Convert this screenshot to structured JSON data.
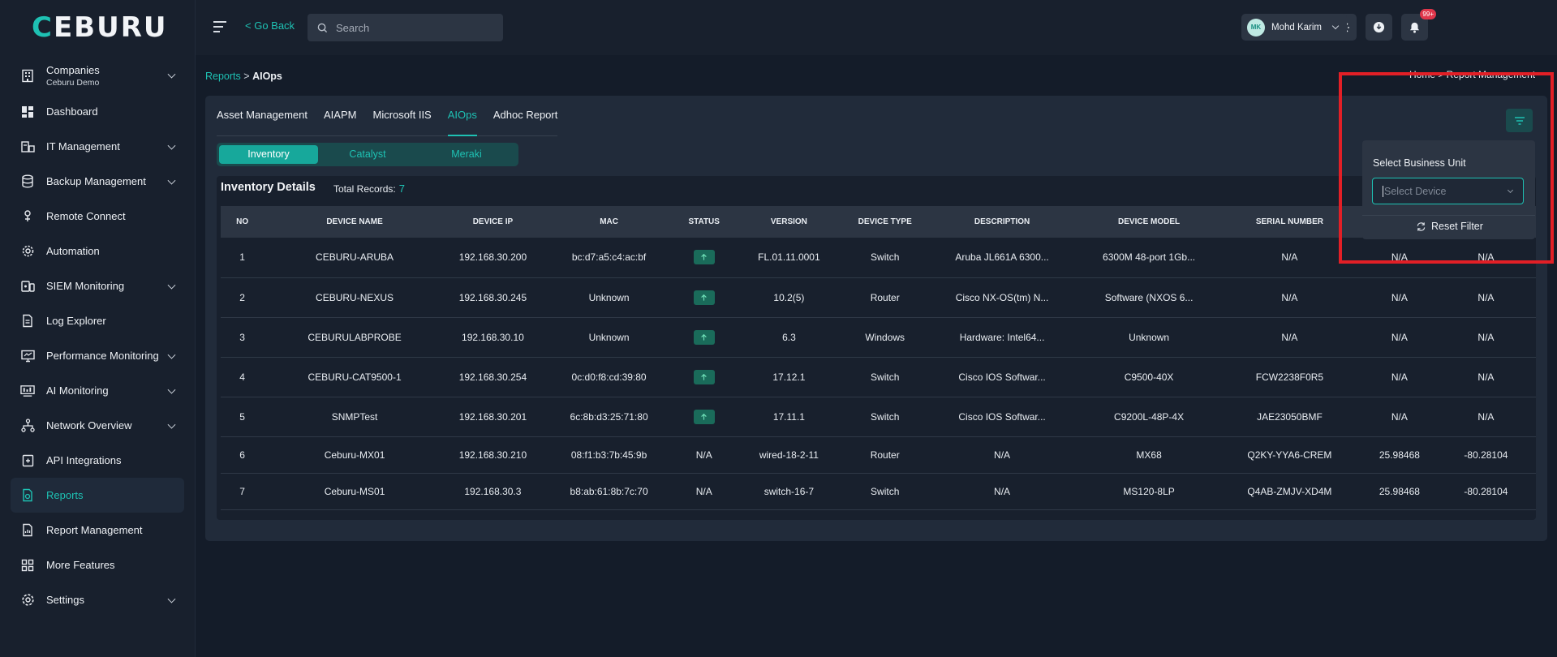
{
  "app": {
    "logo": "EBURU",
    "logo_accent": "C"
  },
  "sidebar": {
    "items": [
      {
        "label": "Companies",
        "sub": "Ceburu Demo",
        "icon": "building-icon",
        "chevron": true
      },
      {
        "label": "Dashboard",
        "icon": "grid-icon",
        "chevron": false
      },
      {
        "label": "IT Management",
        "icon": "server-icon",
        "chevron": true
      },
      {
        "label": "Backup Management",
        "icon": "database-icon",
        "chevron": true
      },
      {
        "label": "Remote Connect",
        "icon": "remote-icon",
        "chevron": false
      },
      {
        "label": "Automation",
        "icon": "gear-icon",
        "chevron": false
      },
      {
        "label": "SIEM Monitoring",
        "icon": "siem-icon",
        "chevron": true
      },
      {
        "label": "Log Explorer",
        "icon": "document-icon",
        "chevron": false
      },
      {
        "label": "Performance Monitoring",
        "icon": "monitor-icon",
        "chevron": true
      },
      {
        "label": "AI Monitoring",
        "icon": "ai-monitor-icon",
        "chevron": true
      },
      {
        "label": "Network Overview",
        "icon": "network-icon",
        "chevron": true
      },
      {
        "label": "API Integrations",
        "icon": "api-icon",
        "chevron": false
      },
      {
        "label": "Reports",
        "icon": "report-icon",
        "chevron": false,
        "active": true
      },
      {
        "label": "Report Management",
        "icon": "report-manage-icon",
        "chevron": false
      },
      {
        "label": "More Features",
        "icon": "apps-icon",
        "chevron": false
      },
      {
        "label": "Settings",
        "icon": "settings-icon",
        "chevron": true
      }
    ]
  },
  "header": {
    "go_back": "< Go Back",
    "search_placeholder": "Search",
    "notification_badge": "99+",
    "user_initials": "MK",
    "user_name": "Mohd Karim"
  },
  "breadcrumb": {
    "parent": "Reports",
    "separator": ">",
    "current": "AIOps",
    "right": "Home > Report Management"
  },
  "tabs": [
    "Asset Management",
    "AIAPM",
    "Microsoft IIS",
    "AIOps",
    "Adhoc Report"
  ],
  "active_tab": "AIOps",
  "subtabs": [
    "Inventory",
    "Catalyst",
    "Meraki"
  ],
  "active_subtab": "Inventory",
  "inventory": {
    "title": "Inventory Details",
    "total_label": "Total Records:",
    "total": "7",
    "columns": [
      "NO",
      "DEVICE NAME",
      "DEVICE IP",
      "MAC",
      "STATUS",
      "VERSION",
      "DEVICE TYPE",
      "DESCRIPTION",
      "DEVICE MODEL",
      "SERIAL NUMBER",
      "",
      ""
    ],
    "rows": [
      [
        "1",
        "CEBURU-ARUBA",
        "192.168.30.200",
        "bc:d7:a5:c4:ac:bf",
        "up",
        "FL.01.11.0001",
        "Switch",
        "Aruba JL661A 6300...",
        "6300M 48-port 1Gb...",
        "N/A",
        "N/A",
        "N/A"
      ],
      [
        "2",
        "CEBURU-NEXUS",
        "192.168.30.245",
        "Unknown",
        "up",
        "10.2(5)",
        "Router",
        "Cisco NX-OS(tm) N...",
        "Software (NXOS 6...",
        "N/A",
        "N/A",
        "N/A"
      ],
      [
        "3",
        "CEBURULABPROBE",
        "192.168.30.10",
        "Unknown",
        "up",
        "6.3",
        "Windows",
        "Hardware: Intel64...",
        "Unknown",
        "N/A",
        "N/A",
        "N/A"
      ],
      [
        "4",
        "CEBURU-CAT9500-1",
        "192.168.30.254",
        "0c:d0:f8:cd:39:80",
        "up",
        "17.12.1",
        "Switch",
        "Cisco IOS Softwar...",
        "C9500-40X",
        "FCW2238F0R5",
        "N/A",
        "N/A"
      ],
      [
        "5",
        "SNMPTest",
        "192.168.30.201",
        "6c:8b:d3:25:71:80",
        "up",
        "17.11.1",
        "Switch",
        "Cisco IOS Softwar...",
        "C9200L-48P-4X",
        "JAE23050BMF",
        "N/A",
        "N/A"
      ],
      [
        "6",
        "Ceburu-MX01",
        "192.168.30.210",
        "08:f1:b3:7b:45:9b",
        "N/A",
        "wired-18-2-11",
        "Router",
        "N/A",
        "MX68",
        "Q2KY-YYA6-CREM",
        "25.98468",
        "-80.28104"
      ],
      [
        "7",
        "Ceburu-MS01",
        "192.168.30.3",
        "b8:ab:61:8b:7c:70",
        "N/A",
        "switch-16-7",
        "Switch",
        "N/A",
        "MS120-8LP",
        "Q4AB-ZMJV-XD4M",
        "25.98468",
        "-80.28104"
      ]
    ]
  },
  "filter_panel": {
    "title": "Select Business Unit",
    "select_placeholder": "Select Device",
    "reset_label": "Reset Filter"
  },
  "colors": {
    "accent": "#1ec1b3",
    "background": "#141c29",
    "annotation_box": "#e21f26"
  }
}
